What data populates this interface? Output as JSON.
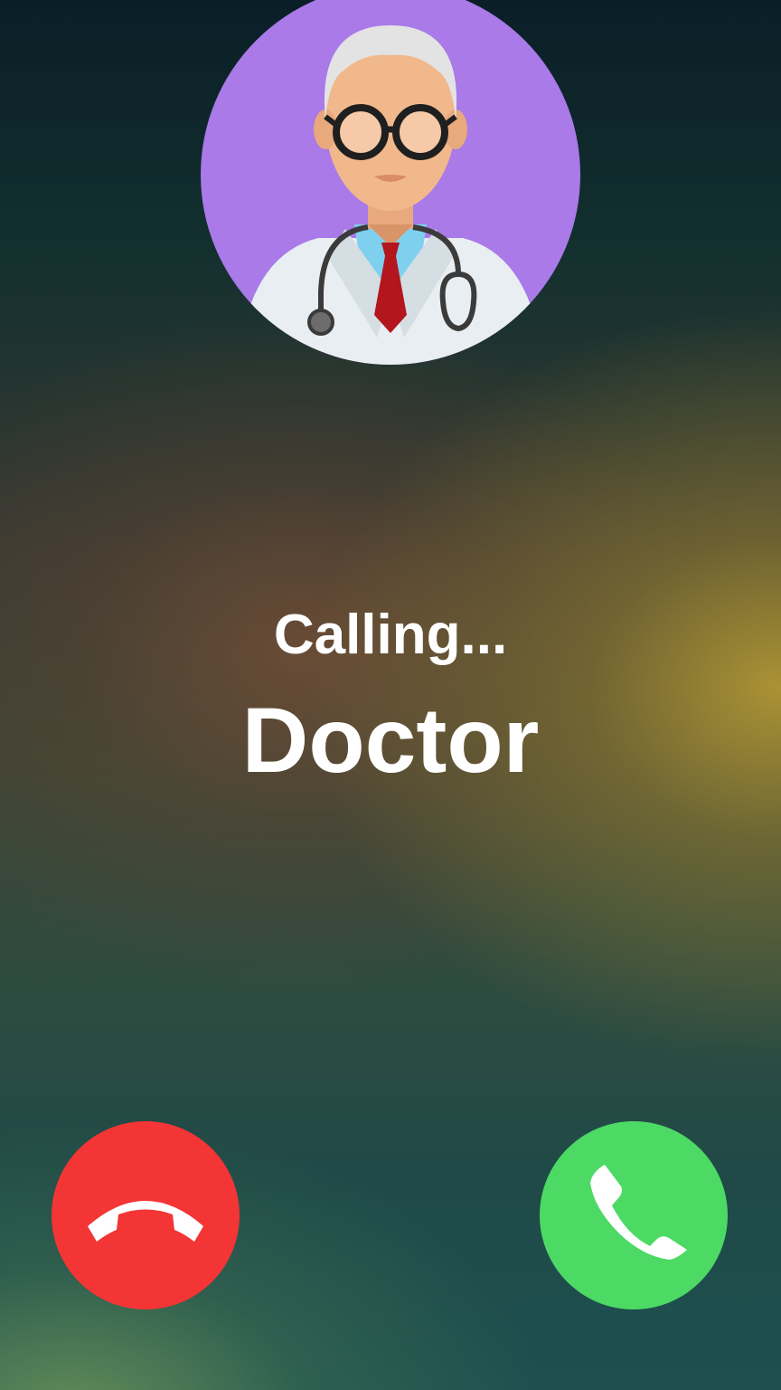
{
  "call": {
    "status": "Calling...",
    "caller_name": "Doctor"
  },
  "avatar": {
    "icon": "doctor-avatar-icon",
    "background_color": "#a97ae8"
  },
  "actions": {
    "decline": {
      "icon": "phone-hangup-icon",
      "color": "#f33535"
    },
    "accept": {
      "icon": "phone-icon",
      "color": "#4cd964"
    }
  }
}
